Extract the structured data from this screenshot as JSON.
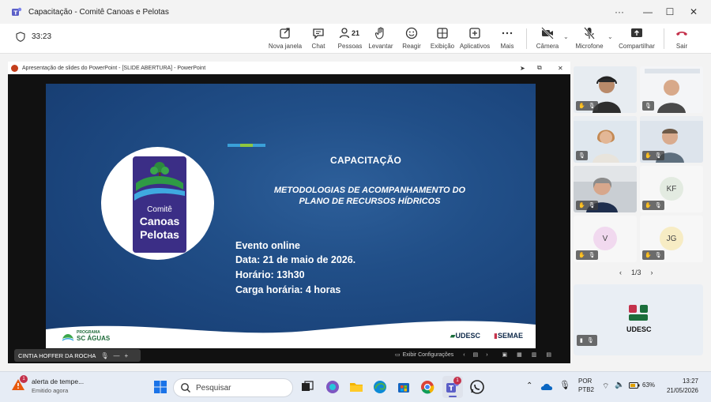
{
  "window": {
    "title": "Capacitação - Comitê Canoas e Pelotas",
    "controls": {
      "more": "···",
      "minimize": "—",
      "maximize": "☐",
      "close": "✕"
    }
  },
  "toolbar": {
    "timer": "33:23",
    "buttons": {
      "new_window": "Nova janela",
      "chat": "Chat",
      "people": "Pessoas",
      "people_count": "21",
      "raise": "Levantar",
      "react": "Reagir",
      "view": "Exibição",
      "apps": "Aplicativos",
      "more": "Mais",
      "camera": "Câmera",
      "mic": "Microfone",
      "share": "Compartilhar",
      "leave": "Sair"
    }
  },
  "presentation": {
    "window_title": "Apresentação de slides do PowerPoint - [SLIDE ABERTURA] - PowerPoint",
    "slide": {
      "heading": "CAPACITAÇÃO",
      "subtitle_line1": "METODOLOGIAS DE ACOMPANHAMENTO DO",
      "subtitle_line2": "PLANO DE RECURSOS HÍDRICOS",
      "info": [
        "Evento online",
        "Data: 21 de maio de 2026.",
        "Horário: 13h30",
        "Carga horária: 4 horas"
      ],
      "logo": {
        "line1": "Comitê",
        "line2": "Canoas",
        "line3": "Pelotas"
      },
      "footer": {
        "programa_top": "PROGRAMA",
        "programa_bottom": "SC ÁGUAS",
        "udesc": "UDESC",
        "semae": "SEMAE"
      }
    },
    "presenter_name": "CINTIA HOFFER DA ROCHA",
    "ppt_controls_label": "Exibir Configurações"
  },
  "gallery": {
    "participants": [
      {
        "type": "video"
      },
      {
        "type": "video"
      },
      {
        "type": "video"
      },
      {
        "type": "video"
      },
      {
        "type": "video"
      },
      {
        "initials": "KF",
        "color": "#e3ebe1"
      },
      {
        "initials": "V",
        "color": "#f1d9ef"
      },
      {
        "initials": "JG",
        "color": "#f7ecc4"
      }
    ],
    "pager": "1/3"
  },
  "taskbar": {
    "notification_title": "alerta de tempe...",
    "notification_sub": "Emitido agora",
    "notification_badge": "1",
    "search_placeholder": "Pesquisar",
    "teams_badge": "1",
    "lang_top": "POR",
    "lang_bottom": "PTB2",
    "battery": "63%",
    "time": "13:27",
    "date": "21/05/2026"
  }
}
